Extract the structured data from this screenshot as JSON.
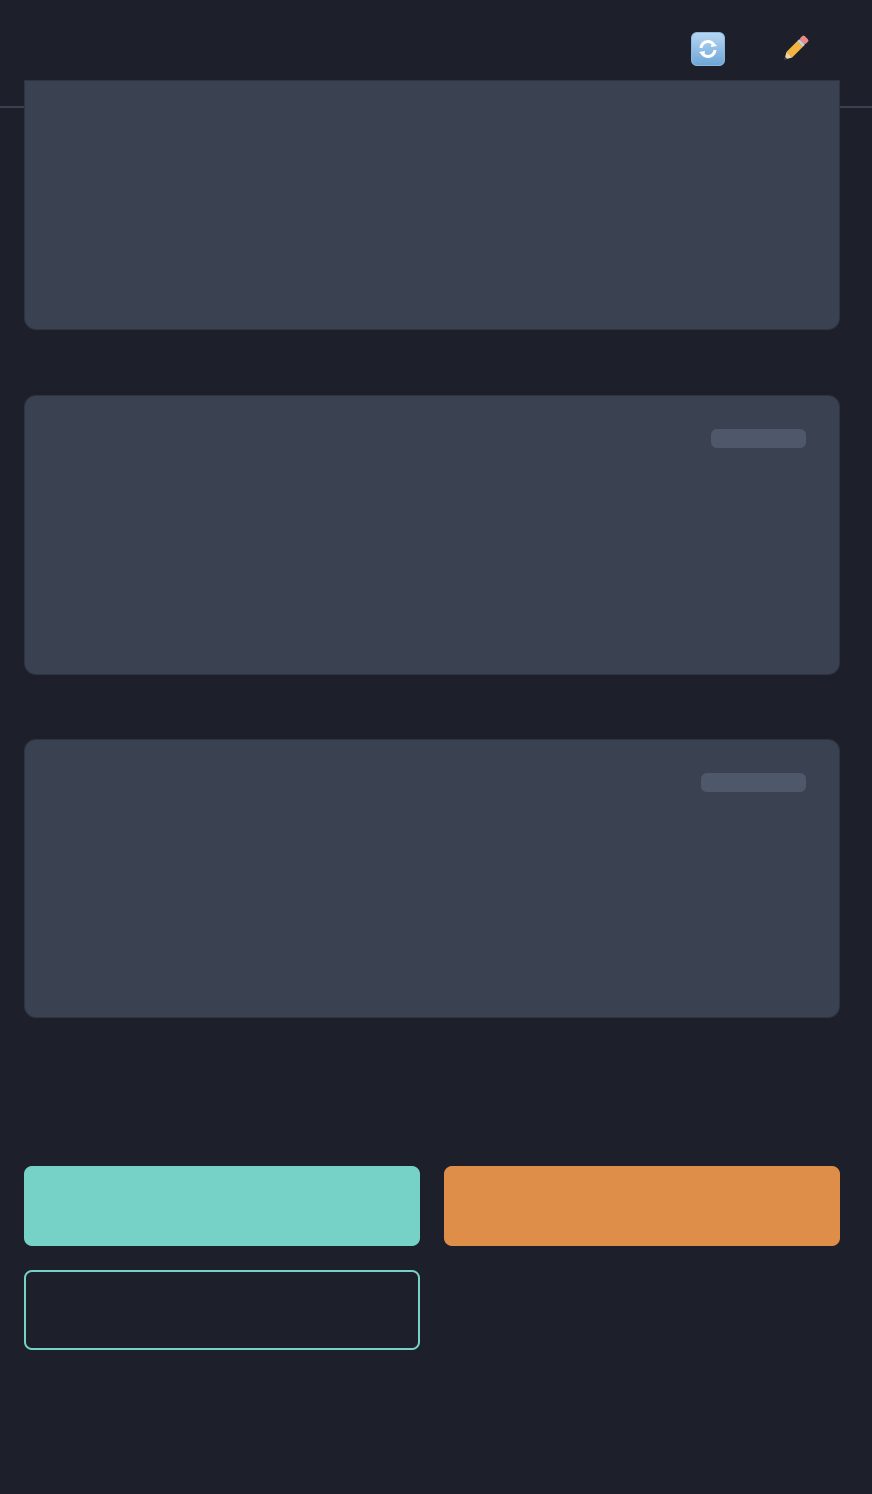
{
  "header": {
    "title": "",
    "refresh_icon": "refresh-icon",
    "edit_icon": "pencil-icon"
  },
  "cards": [
    {
      "text": ""
    },
    {
      "text": ""
    },
    {
      "text": ""
    }
  ],
  "actions": {
    "primary_label": "",
    "accent_label": "",
    "outline_label": "",
    "ghost_label": ""
  },
  "colors": {
    "background": "#1d202a",
    "card": "#3a4150",
    "teal": "#76d1c6",
    "orange": "#df8e4a"
  }
}
